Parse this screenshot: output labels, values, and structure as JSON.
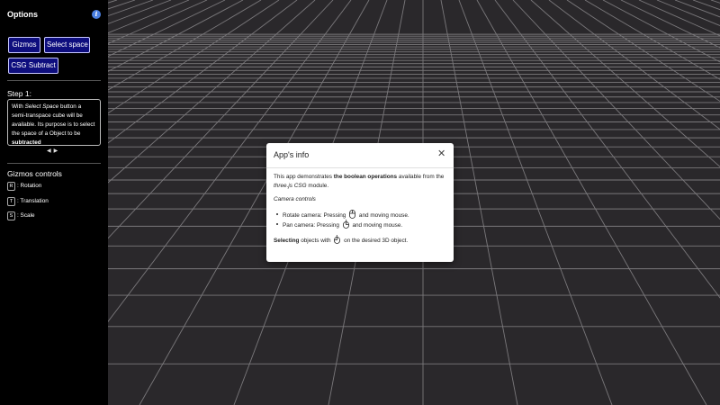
{
  "sidebar": {
    "title": "Options",
    "buttons": {
      "gizmos": "Gizmos",
      "select_space": "Select space",
      "csg_subtract": "CSG Subtract"
    },
    "step": {
      "title": "Step 1:",
      "text_1": "With",
      "text_italic": "Select Space",
      "text_2": "button a semi-transpace cube will be available. Its purpose is to select the space of a Object to be",
      "text_bold": "subtracted"
    },
    "gizmos_controls": {
      "title": "Gizmos controls",
      "items": [
        {
          "key": "R",
          "label": ": Rotation"
        },
        {
          "key": "T",
          "label": ": Translation"
        },
        {
          "key": "S",
          "label": ": Scale"
        }
      ]
    }
  },
  "modal": {
    "title": "App's info",
    "intro_1": "This app demonstrates",
    "intro_bold": "the boolean operations",
    "intro_2": "available from the",
    "intro_italic": "three.js CSG",
    "intro_3": "module.",
    "camera_controls": "Camera controls",
    "rotate_1": "Rotate camera: Pressing",
    "rotate_2": "and moving mouse.",
    "pan_1": "Pan camera: Pressing",
    "pan_2": "and moving mouse.",
    "select_bold": "Selecting",
    "select_1": "objects with",
    "select_2": "on the desired 3D object."
  },
  "colors": {
    "background": "#2a282b",
    "grid": "#7a787b",
    "sidebar": "#000000",
    "button": "#0e0e7e",
    "info_icon": "#4a7fe0"
  }
}
